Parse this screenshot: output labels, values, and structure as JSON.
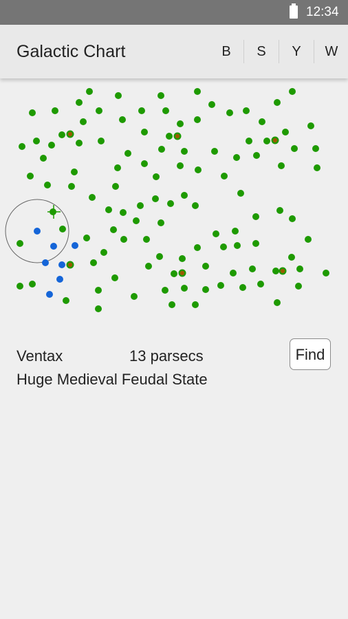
{
  "status_bar": {
    "time": "12:34",
    "battery_icon": "battery-full-icon"
  },
  "app_bar": {
    "title": "Galactic Chart",
    "menu": [
      {
        "label": "B",
        "name": "menu-b-button"
      },
      {
        "label": "S",
        "name": "menu-s-button"
      },
      {
        "label": "Y",
        "name": "menu-y-button"
      },
      {
        "label": "W",
        "name": "menu-w-button"
      }
    ]
  },
  "selected_system": {
    "name": "Ventax",
    "distance": "13 parsecs",
    "description": "Huge Medieval Feudal State"
  },
  "find_label": "Find",
  "colors": {
    "star": "#1e9a00",
    "in_range": "#1565d8",
    "special": "#9a5a00",
    "selector": "#666666"
  }
}
